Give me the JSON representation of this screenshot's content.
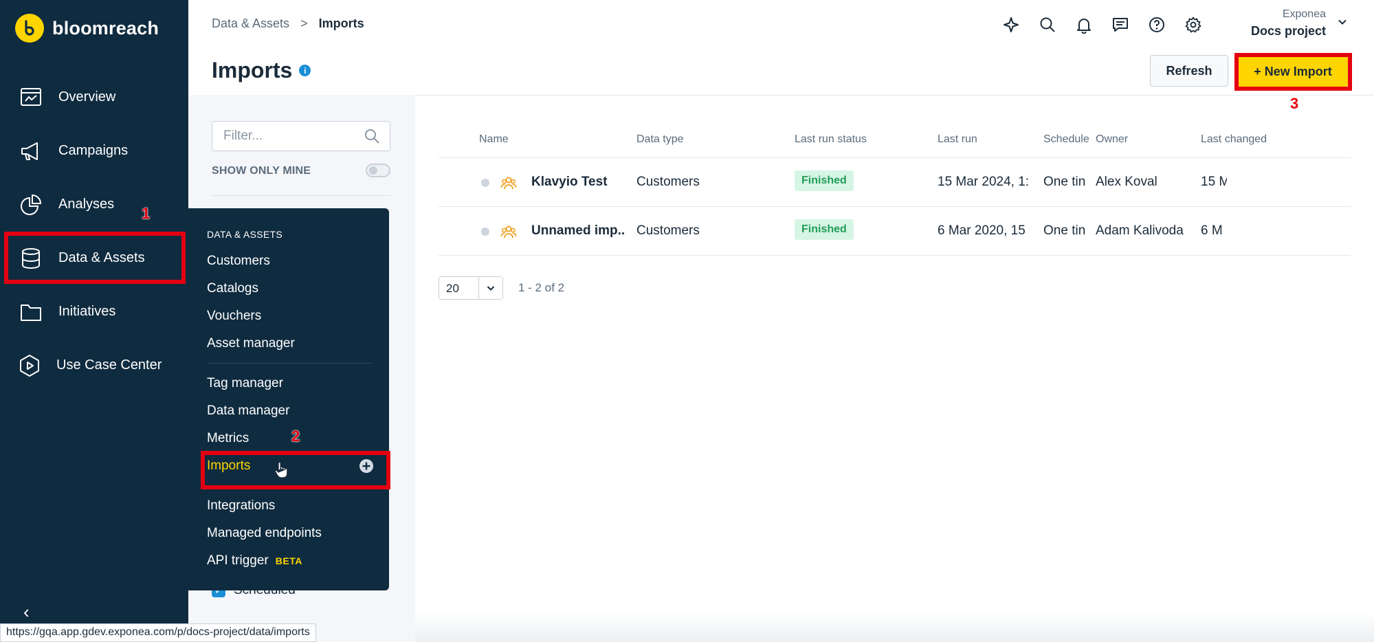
{
  "brand": {
    "name": "bloomreach",
    "accent": "#ffd500",
    "sidebar_bg": "#0f2b3f"
  },
  "sidebar": {
    "items": [
      {
        "label": "Overview",
        "icon": "overview-dashboard-icon"
      },
      {
        "label": "Campaigns",
        "icon": "megaphone-icon"
      },
      {
        "label": "Analyses",
        "icon": "pie-chart-icon"
      },
      {
        "label": "Data & Assets",
        "icon": "database-icon"
      },
      {
        "label": "Initiatives",
        "icon": "folder-icon"
      },
      {
        "label": "Use Case Center",
        "icon": "play-hexagon-icon"
      }
    ],
    "collapse_icon": "chevron-left-icon"
  },
  "flyout": {
    "group_title": "DATA & ASSETS",
    "items": [
      "Customers",
      "Catalogs",
      "Vouchers",
      "Asset manager",
      "Tag manager",
      "Data manager",
      "Metrics",
      "Imports",
      "Integrations",
      "Managed endpoints",
      "API trigger"
    ],
    "beta_label": "BETA",
    "active": "Imports"
  },
  "annotations": {
    "one": "1",
    "two": "2",
    "three": "3",
    "color": "#e40010"
  },
  "header": {
    "breadcrumb": [
      "Data & Assets",
      "Imports"
    ],
    "breadcrumb_separator": ">",
    "project_org": "Exponea",
    "project_name": "Docs project",
    "icons": [
      "sparkle-icon",
      "search-icon",
      "bell-icon",
      "chat-icon",
      "help-icon",
      "gear-icon"
    ]
  },
  "page": {
    "title": "Imports",
    "info_glyph": "i",
    "refresh_label": "Refresh",
    "new_import_label": "+ New Import"
  },
  "filters": {
    "placeholder": "Filter...",
    "show_only_mine": "SHOW ONLY MINE",
    "show_only_mine_on": false,
    "scheduled_label": "Scheduled",
    "scheduled_checked": true
  },
  "table": {
    "columns": [
      "Name",
      "Data type",
      "Last run status",
      "Last run",
      "Schedule",
      "Owner",
      "Last changed"
    ],
    "rows": [
      {
        "name": "Klavyio Test",
        "data_type": "Customers",
        "status": "Finished",
        "last_run": "15 Mar 2024, 1:",
        "schedule": "One tin",
        "owner": "Alex Koval",
        "last_changed": "15 M"
      },
      {
        "name": "Unnamed imp..",
        "data_type": "Customers",
        "status": "Finished",
        "last_run": "6 Mar 2020, 15",
        "schedule": "One tin",
        "owner": "Adam Kalivoda",
        "last_changed": "6 M"
      }
    ]
  },
  "pager": {
    "page_size": "20",
    "count": "1 - 2 of 2"
  },
  "status_url": "https://gqa.app.gdev.exponea.com/p/docs-project/data/imports"
}
